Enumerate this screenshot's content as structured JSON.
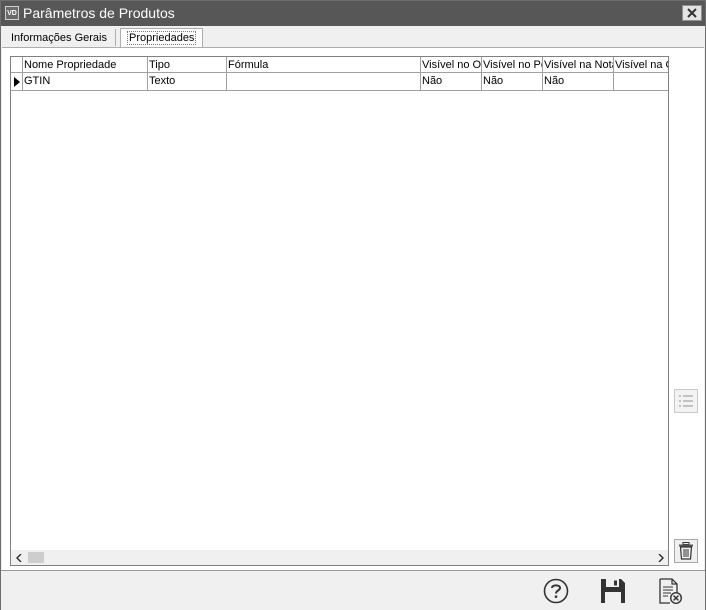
{
  "window": {
    "app_icon_label": "VD",
    "title": "Parâmetros de Produtos",
    "close_icon": "close-icon"
  },
  "tabs": [
    {
      "label": "Informações Gerais",
      "active": false
    },
    {
      "label": "Propriedades",
      "active": true
    }
  ],
  "grid": {
    "columns": [
      "Nome Propriedade",
      "Tipo",
      "Fórmula",
      "Visível no Orçamento",
      "Visível no Pedido",
      "Visível na Nota",
      "Visível na O"
    ],
    "rows": [
      {
        "current": true,
        "cells": [
          "GTIN",
          "Texto",
          "",
          "Não",
          "Não",
          "Não",
          ""
        ]
      }
    ]
  },
  "side_buttons": {
    "list_icon": "list-icon",
    "delete_icon": "trash-icon"
  },
  "footer": {
    "help_icon": "help-icon",
    "save_icon": "save-icon",
    "cancel_icon": "cancel-document-icon"
  }
}
